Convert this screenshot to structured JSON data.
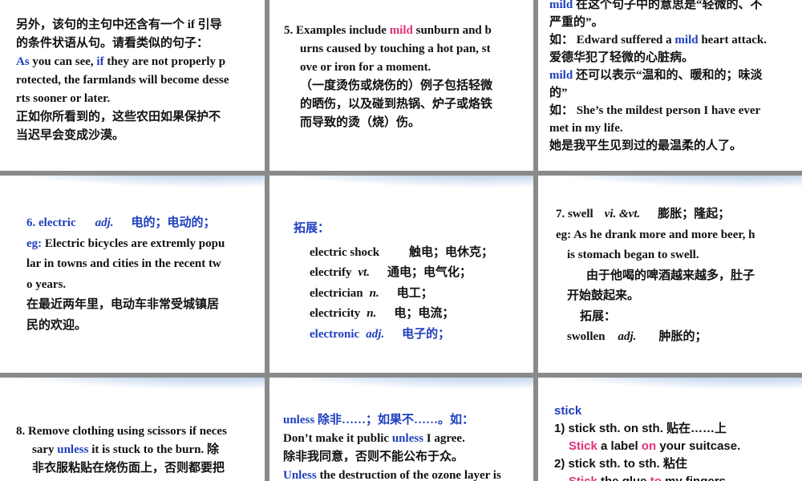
{
  "p1": {
    "l1": "另外，该句的主句中还含有一个 if 引导",
    "l2": "的条件状语从句。请看类似的句子：",
    "l3a": "As",
    "l3b": " you can see, ",
    "l3c": "if",
    "l3d": " they are not properly p",
    "l4": "rotected, the farmlands will become desse",
    "l5": "rts sooner or later.",
    "l6": "正如你所看到的，这些农田如果保护不",
    "l7": "当迟早会变成沙漠。"
  },
  "p2": {
    "l1a": "5. Examples include ",
    "l1b": "mild",
    "l1c": " sunburn and b",
    "l2": "urns caused by touching a hot pan, st",
    "l3": "ove or iron for a moment.",
    "l4": "（一度烫伤或烧伤的）例子包括轻微",
    "l5": "的晒伤，以及碰到热锅、炉子或烙铁",
    "l6": "而导致的烫（烧）伤。"
  },
  "p3": {
    "l1a": "mild",
    "l1b": " 在这个句子中的意思是“轻微的、不",
    "l2": "严重的”。",
    "l3a": "如：  Edward suffered a ",
    "l3b": "mild",
    "l3c": " heart attack.",
    "l4": "爱德华犯了轻微的心脏病。",
    "l5a": "mild",
    "l5b": " 还可以表示“温和的、暖和的；味淡",
    "l6": "的”",
    "l7": "如：  She’s the mildest person I have ever",
    "l8": "met in my life.",
    "l9": "她是我平生见到过的最温柔的人了。"
  },
  "p4": {
    "l1a": "6. electric",
    "l1b": "adj.",
    "l1c": "电的；电动的；",
    "l2a": "eg:",
    "l2b": " Electric bicycles are extremly popu",
    "l3": "lar in towns and cities in the recent tw",
    "l4": "o years.",
    "l5": "在最近两年里，电动车非常受城镇居",
    "l6": "民的欢迎。"
  },
  "p5": {
    "head": "拓展：",
    "rows": [
      {
        "w": "electric shock",
        "pos": "",
        "m": "触电；电休克；"
      },
      {
        "w": "electrify",
        "pos": "vt.",
        "m": "通电；电气化；"
      },
      {
        "w": "electrician",
        "pos": "n.",
        "m": "电工；"
      },
      {
        "w": "electricity",
        "pos": "n.",
        "m": "电；电流；"
      },
      {
        "w": "electronic",
        "pos": "adj.",
        "m": "电子的；"
      }
    ]
  },
  "p6": {
    "l1a": "7. swell",
    "l1b": "vi. &vt.",
    "l1c": "膨胀；隆起；",
    "l2": "eg: As he drank more and more beer, h",
    "l3": "is stomach began to swell.",
    "l4": "由于他喝的啤酒越来越多，肚子",
    "l5": "开始鼓起来。",
    "l6": "拓展：",
    "l7a": "swollen",
    "l7b": "adj.",
    "l7c": "肿胀的；"
  },
  "p7": {
    "l1": "8. Remove clothing using scissors if neces",
    "l2a": "sary ",
    "l2b": "unless",
    "l2c": " it is stuck to the burn. 除",
    "l3": "非衣服粘贴在烧伤面上，否则都要把"
  },
  "p8": {
    "l1a": "unless",
    "l1b": " 除非……；如果不……。如：",
    "l2a": "Don’t make it public ",
    "l2b": "unless",
    "l2c": " I agree.",
    "l3": "除非我同意，否则不能公布于众。",
    "l4a": "Unless",
    "l4b": " the destruction of the ozone layer is"
  },
  "p9": {
    "l1": "stick",
    "l2": "1) stick sth. on sth.   贴在……上",
    "l3a": "Stick",
    "l3b": " a label ",
    "l3c": "on",
    "l3d": " your suitcase.",
    "l4": "2) stick sth. to sth.     粘住",
    "l5a": "Stick",
    "l5b": " the glue ",
    "l5c": "to",
    "l5d": " my fingers."
  }
}
